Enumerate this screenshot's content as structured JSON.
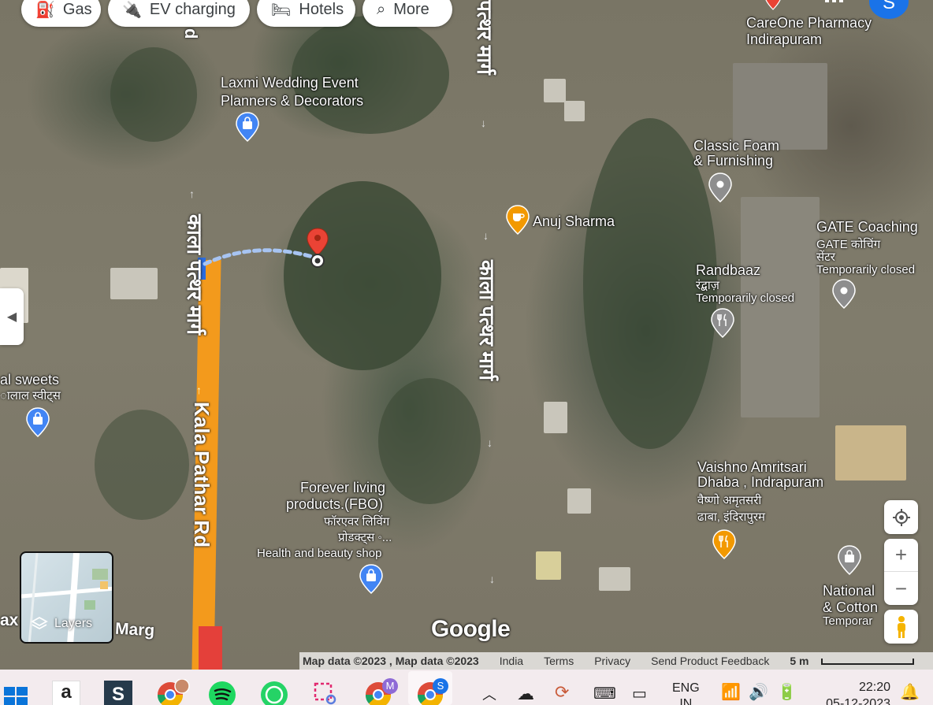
{
  "chips": [
    {
      "icon": "gas-station-icon",
      "glyph": "⛽",
      "label": "Gas"
    },
    {
      "icon": "ev-charging-icon",
      "glyph": "🔌",
      "label": "EV charging"
    },
    {
      "icon": "hotel-bed-icon",
      "glyph": "🛏",
      "label": "Hotels"
    },
    {
      "icon": "search-icon",
      "glyph": "⌕",
      "label": "More"
    }
  ],
  "account": {
    "initial": "S"
  },
  "roads": {
    "kala_pathar_rd_en": "Kala Pathar Rd",
    "kala_pathar_hi_left": "काला पत्थर मार्ग",
    "kala_pathar_hi_mid": "काला पत्थर मार्ग",
    "pathar_marg_top": "पत्थर मार्ग",
    "marg_bottom": "Marg",
    "d_top": "d"
  },
  "pois": {
    "laxmi": {
      "line1": "Laxmi Wedding Event",
      "line2": "Planners & Decorators"
    },
    "careone": {
      "line1": "CareOne Pharmacy",
      "line2": "Indirapuram"
    },
    "classic_foam": {
      "line1": "Classic Foam",
      "line2": "& Furnishing"
    },
    "anuj": {
      "name": "Anuj Sharma"
    },
    "gate": {
      "line1": "GATE Coaching",
      "sub1": "GATE कोचिंग",
      "sub2": "सेंटर",
      "sub3": "Temporarily closed"
    },
    "randbaaz": {
      "line1": "Randbaaz",
      "sub1": "रंद्बाज़",
      "sub2": "Temporarily closed"
    },
    "sweets": {
      "line1": "al sweets",
      "sub1": "ालाल स्वीट्स"
    },
    "forever": {
      "line1": "Forever living",
      "line2": "products.(FBO)",
      "sub1": "फॉरएवर लिविंग",
      "sub2": "प्रोडक्ट्स ◦...",
      "sub3": "Health and beauty shop"
    },
    "vaishno": {
      "line1": "Vaishno Amritsari",
      "line2": "Dhaba , Indrapuram",
      "sub1": "वैष्णो अमृतसरी",
      "sub2": "ढाबा, इंदिरापुरम"
    },
    "national": {
      "line1": "National",
      "line2": "& Cotton",
      "sub1": "Temporar"
    },
    "left_edge": {
      "line1": "ax"
    }
  },
  "layers": {
    "label": "Layers"
  },
  "google_logo": "Google",
  "attribution": {
    "map_data": "Map data ©2023 , Map data ©2023",
    "india": "India",
    "terms": "Terms",
    "privacy": "Privacy",
    "feedback": "Send Product Feedback",
    "scale": "5 m"
  },
  "taskbar": {
    "language": "ENG",
    "region": "IN",
    "time": "22:20",
    "date": "05-12-2023",
    "apps": [
      "windows-start",
      "amazon",
      "app-s",
      "chrome-profile-1",
      "spotify",
      "whatsapp",
      "snipping-tool",
      "chrome-profile-m",
      "chrome-profile-s"
    ],
    "chrome_m_badge": "M",
    "chrome_s_badge": "S"
  },
  "colors": {
    "route_orange": "#f39a1c",
    "route_red": "#e4403a",
    "pin_red": "#ea4335",
    "shop_pin_blue": "#4285f4",
    "food_pin_orange": "#f29900",
    "grey_pin": "#8e8e8e",
    "accent_blue": "#1a73e8"
  }
}
